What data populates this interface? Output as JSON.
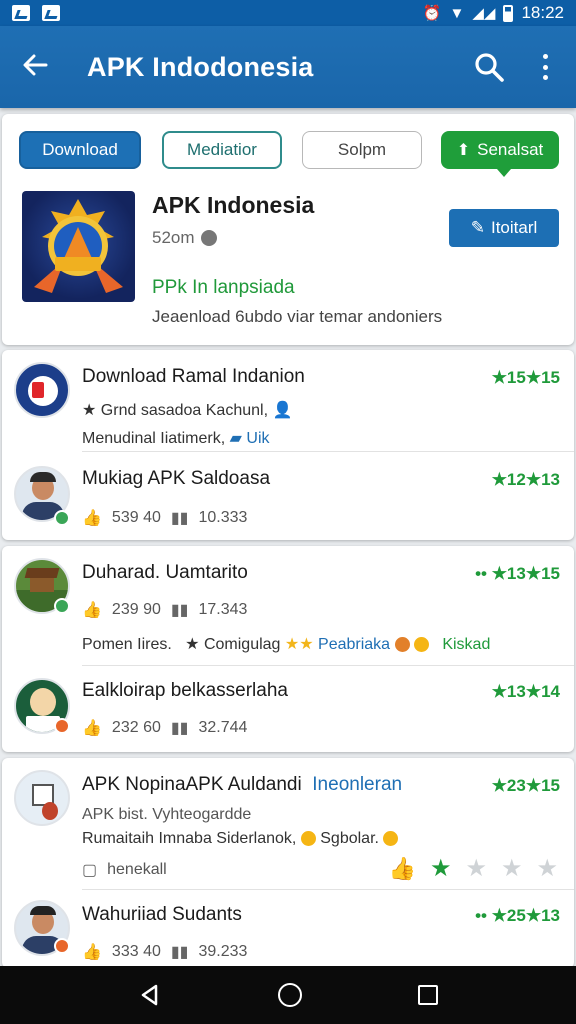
{
  "status_bar": {
    "time": "18:22"
  },
  "app_bar": {
    "title": "APK  Indodonesia"
  },
  "chips": {
    "download": "Download",
    "mediator": "Mediatior",
    "solpm": "Solpm",
    "senaleat": "Senalsat"
  },
  "header": {
    "name": "APK Indonesia",
    "size": "52om",
    "developer": "PPk  In lanpsiada",
    "description": "Jeaenload 6ubdo viar temar andoniers",
    "install_label": "Itoitarl"
  },
  "list_a": [
    {
      "name": "Download Ramal Indanion",
      "rating": "★15★15",
      "line1": "Grnd sasadoa Kachunl,",
      "line2": "Menudinal  Iiatimerk,",
      "line2_tag": "Uik"
    },
    {
      "name": "Mukiag APK Saldoasa",
      "rating": "★12★13",
      "likes": "539 40",
      "downloads": "10.333"
    }
  ],
  "list_b": [
    {
      "name": "Duharad. Uamtarito",
      "rating": "•• ★13★15",
      "likes": "239 90",
      "downloads": "17.343",
      "tag1": "Pomen Iires.",
      "tag2": "Comigulag",
      "tag3": "Peabriaka",
      "tag4": "Kiskad"
    },
    {
      "name": "Ealkloirap belkasserlaha",
      "rating": "★13★14",
      "likes": "232 60",
      "downloads": "32.744"
    }
  ],
  "list_c": [
    {
      "name": "APK NopinaAPK Auldandi",
      "tag": "Ineonleran",
      "rating": "★23★15",
      "line1": "APK bist. Vyhteogardde",
      "line2": "Rumaitaih Imnaba Siderlanok,",
      "line2b": "Sgbolar.",
      "action": "henekall",
      "stars_rating": 2
    },
    {
      "name": "Wahuriiad Sudants",
      "rating": "•• ★25★13",
      "likes": "333 40",
      "downloads": "39.233"
    }
  ]
}
